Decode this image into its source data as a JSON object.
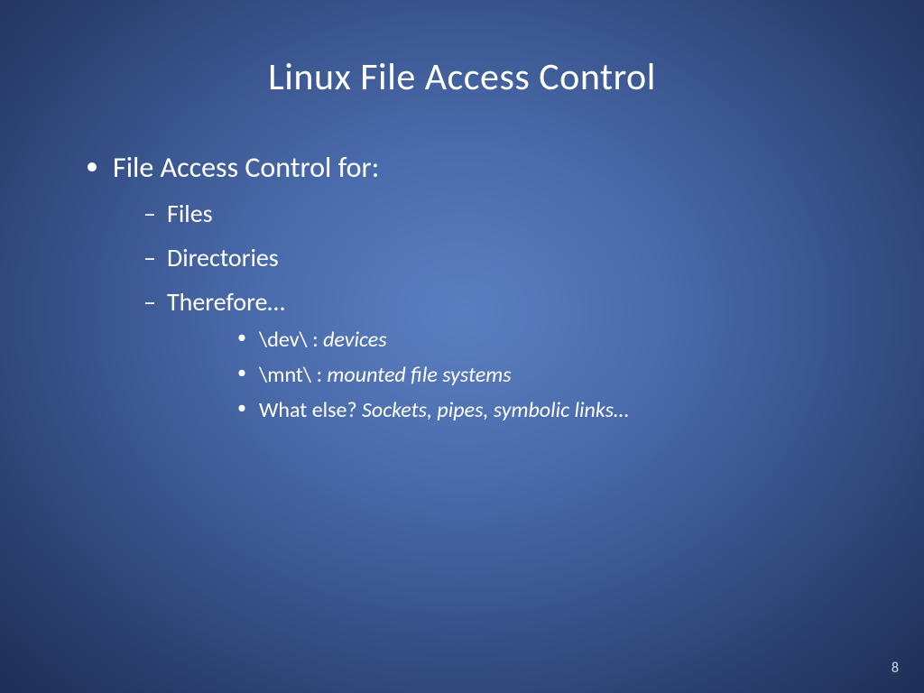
{
  "slide": {
    "title": "Linux File Access Control",
    "bullet1": "File Access Control for:",
    "sub1": "Files",
    "sub2": "Directories",
    "sub3": "Therefore…",
    "subsub1_prefix": "\\dev\\ : ",
    "subsub1_italic": "devices",
    "subsub2_prefix": "\\mnt\\ : ",
    "subsub2_italic": "mounted file systems",
    "subsub3_prefix": "What else? ",
    "subsub3_italic": "Sockets, pipes, symbolic links",
    "subsub3_suffix": "…",
    "pageNumber": "8"
  }
}
